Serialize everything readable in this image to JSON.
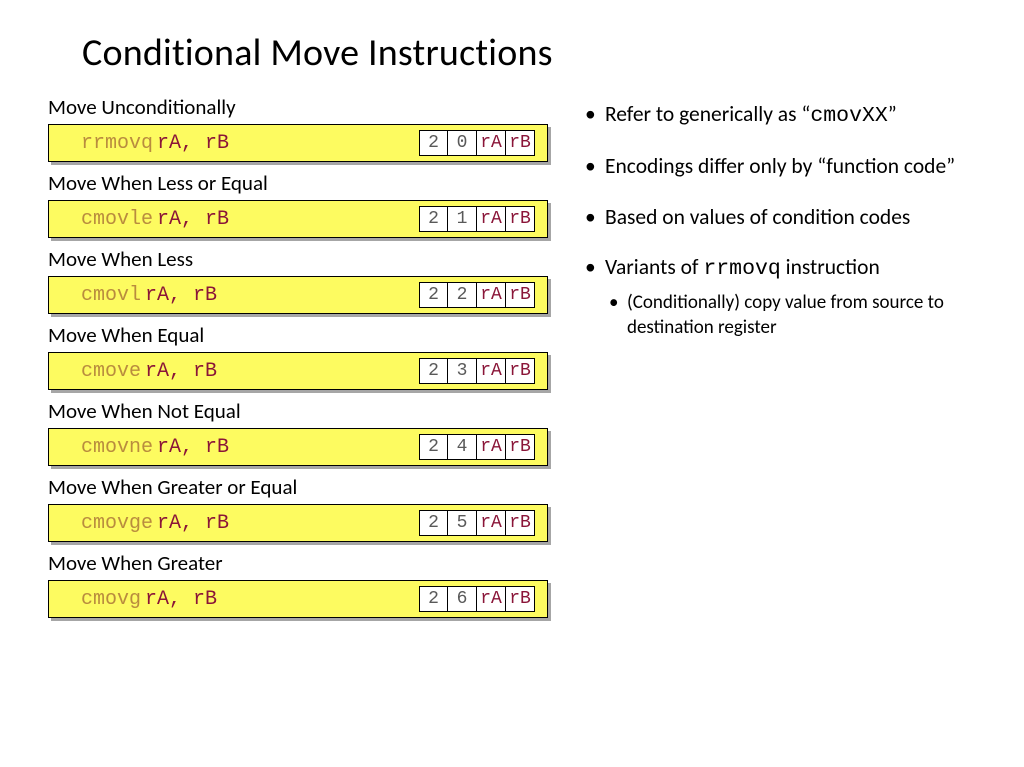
{
  "title": "Conditional Move Instructions",
  "operands_text": "rA, rB",
  "reg_a": "rA",
  "reg_b": "rB",
  "instructions": [
    {
      "label": "Move Unconditionally",
      "mnemonic": "rrmovq",
      "b0": "2",
      "b1": "0"
    },
    {
      "label": "Move When Less or Equal",
      "mnemonic": "cmovle",
      "b0": "2",
      "b1": "1"
    },
    {
      "label": "Move When Less",
      "mnemonic": "cmovl",
      "b0": "2",
      "b1": "2"
    },
    {
      "label": "Move When Equal",
      "mnemonic": "cmove",
      "b0": "2",
      "b1": "3"
    },
    {
      "label": "Move When Not Equal",
      "mnemonic": "cmovne",
      "b0": "2",
      "b1": "4"
    },
    {
      "label": "Move When Greater or Equal",
      "mnemonic": "cmovge",
      "b0": "2",
      "b1": "5"
    },
    {
      "label": "Move When Greater",
      "mnemonic": "cmovg",
      "b0": "2",
      "b1": "6"
    }
  ],
  "bullets": {
    "b1_pre": "Refer to generically as “",
    "b1_code": "cmovXX",
    "b1_post": "”",
    "b2": "Encodings differ only by “function code”",
    "b3": "Based on values of condition codes",
    "b4_pre": "Variants of ",
    "b4_code": "rrmovq",
    "b4_post": " instruction",
    "b4_sub": "(Conditionally) copy value from source to destination register"
  }
}
